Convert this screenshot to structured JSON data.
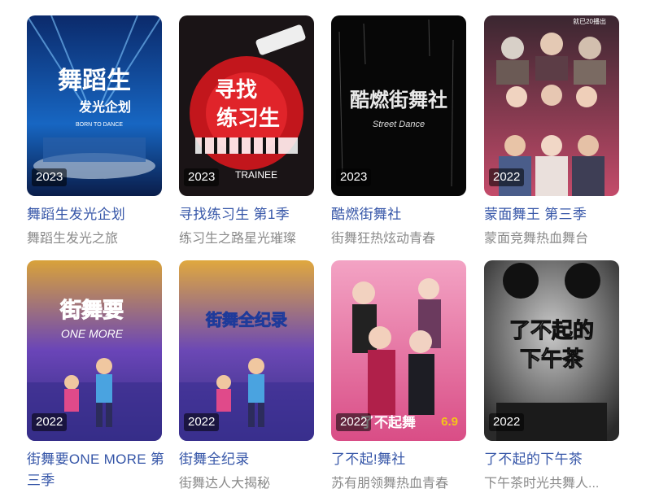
{
  "cards": [
    {
      "year": "2023",
      "title": "舞蹈生发光企划",
      "subtitle": "舞蹈生发光之旅",
      "poster_text": "舞蹈生",
      "poster_text2": "发光企划",
      "poster_small": "BORN TO DANCE"
    },
    {
      "year": "2023",
      "title": "寻找练习生 第1季",
      "subtitle": "练习生之路星光璀璨",
      "poster_text": "寻找",
      "poster_text2": "练习生",
      "poster_small": "TRAINEE"
    },
    {
      "year": "2023",
      "title": "酷燃街舞社",
      "subtitle": "街舞狂热炫动青春",
      "poster_text": "酷燃街舞社",
      "poster_small": "Street Dance"
    },
    {
      "year": "2022",
      "title": "蒙面舞王 第三季",
      "subtitle": "蒙面竞舞热血舞台",
      "poster_small": "就已20播出"
    },
    {
      "year": "2022",
      "title": "街舞要ONE MORE 第三季",
      "subtitle": "",
      "poster_text": "街舞要",
      "poster_small": "ONE MORE"
    },
    {
      "year": "2022",
      "title": "街舞全纪录",
      "subtitle": "街舞达人大揭秘",
      "poster_text": "街舞全纪录"
    },
    {
      "year": "2022",
      "title": "了不起!舞社",
      "subtitle": "苏有朋领舞热血青春",
      "poster_text": "了不起舞",
      "rating": "6.9"
    },
    {
      "year": "2022",
      "title": "了不起的下午茶",
      "subtitle": "下午茶时光共舞人...",
      "poster_text": "了不起的",
      "poster_text2": "下午茶"
    }
  ]
}
